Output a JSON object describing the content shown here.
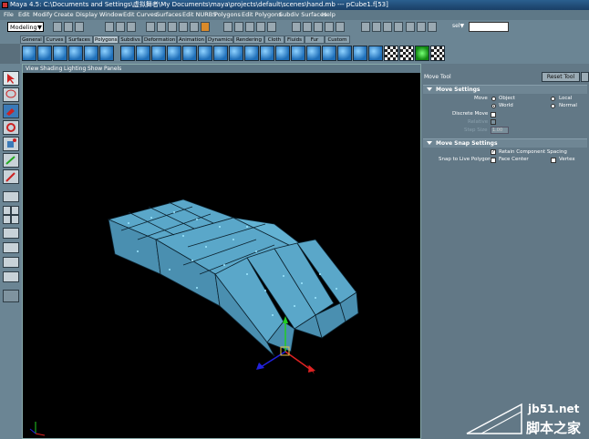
{
  "window": {
    "title": "Maya 4.5: C:\\Documents and Settings\\虚拟舞者\\My Documents\\maya\\projects\\default\\scenes\\hand.mb  ---  pCube1.f[53]"
  },
  "menu": {
    "items": [
      "File",
      "Edit",
      "Modify",
      "Create",
      "Display",
      "Window",
      "Edit Curves",
      "Surfaces",
      "Edit NURBS",
      "Polygons",
      "Edit Polygons",
      "Subdiv Surfaces",
      "Help"
    ]
  },
  "status_line": {
    "mode": "Modeling",
    "selection_label": "sel▼",
    "selection_input": ""
  },
  "shelf": {
    "tabs": [
      "General",
      "Curves",
      "Surfaces",
      "Polygons",
      "Subdivs",
      "Deformation",
      "Animation",
      "Dynamics",
      "Rendering",
      "Cloth",
      "Fluids",
      "Fur",
      "Custom"
    ],
    "active_tab": "Polygons"
  },
  "viewport": {
    "menu": [
      "View",
      "Shading",
      "Lighting",
      "Show",
      "Panels"
    ],
    "object_color": "#5aa7c9",
    "background": "#000000"
  },
  "tool_settings": {
    "tool_name": "Move Tool",
    "reset_label": "Reset Tool",
    "move_settings": {
      "header": "Move Settings",
      "move_label": "Move",
      "options": [
        "Object",
        "Local",
        "World",
        "Normal"
      ],
      "selected": "World",
      "discrete_move": "Discrete Move",
      "relative": "Relative",
      "step_size": "Step Size",
      "step_value": "1.00"
    },
    "snap_settings": {
      "header": "Move Snap Settings",
      "retain_spacing": "Retain Component Spacing",
      "retain_checked": true,
      "snap_live": "Snap to Live Polygon",
      "face_center": "Face Center",
      "vertex": "Vertex",
      "check_mark": "✓"
    }
  },
  "watermark": {
    "site": "jb51.net",
    "name": "脚本之家"
  }
}
